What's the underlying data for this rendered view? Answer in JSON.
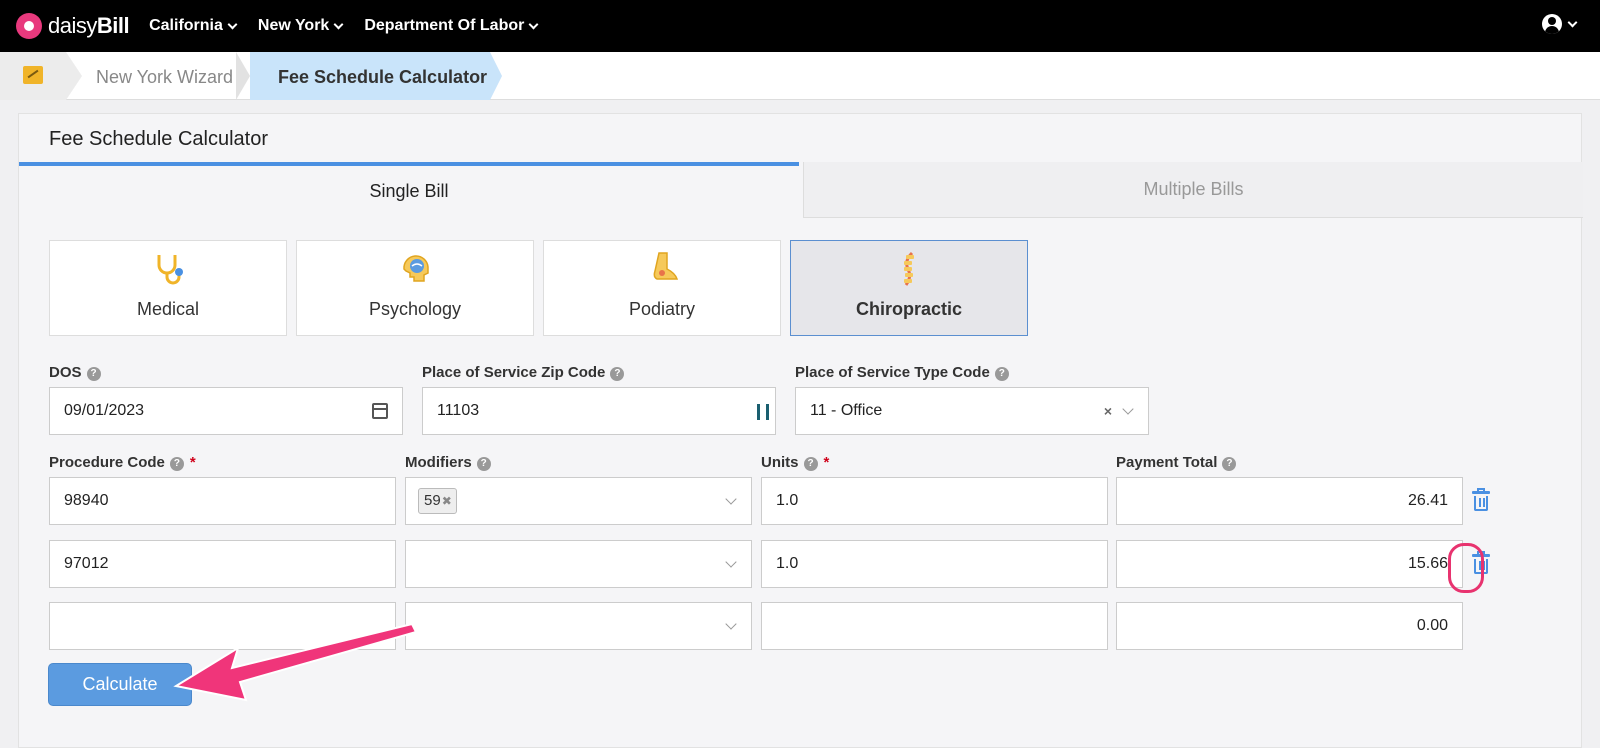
{
  "app": {
    "logo_text_light": "daisy",
    "logo_text_bold": "Bill"
  },
  "nav": {
    "items": [
      "California",
      "New York",
      "Department Of Labor"
    ]
  },
  "breadcrumb": {
    "link": "New York Wizard",
    "current": "Fee Schedule Calculator"
  },
  "panel": {
    "title": "Fee Schedule Calculator",
    "tabs": [
      "Single Bill",
      "Multiple Bills"
    ],
    "active_tab": "Single Bill"
  },
  "specialties": [
    {
      "label": "Medical",
      "icon": "stethoscope-icon",
      "active": false
    },
    {
      "label": "Psychology",
      "icon": "brain-icon",
      "active": false
    },
    {
      "label": "Podiatry",
      "icon": "foot-icon",
      "active": false
    },
    {
      "label": "Chiropractic",
      "icon": "spine-icon",
      "active": true
    }
  ],
  "form": {
    "dos_label": "DOS",
    "dos_value": "09/01/2023",
    "zip_label": "Place of Service Zip Code",
    "zip_value": "11103",
    "pos_type_label": "Place of Service Type Code",
    "pos_type_value": "11 - Office",
    "procedure_label": "Procedure Code",
    "modifiers_label": "Modifiers",
    "units_label": "Units",
    "payment_label": "Payment Total",
    "required_mark": "*",
    "help_glyph": "?"
  },
  "rows": [
    {
      "procedure": "98940",
      "modifiers": [
        "59"
      ],
      "units": "1.0",
      "payment": "26.41",
      "deletable": true
    },
    {
      "procedure": "97012",
      "modifiers": [],
      "units": "1.0",
      "payment": "15.66",
      "deletable": true
    },
    {
      "procedure": "",
      "modifiers": [],
      "units": "",
      "payment": "0.00",
      "deletable": false
    }
  ],
  "actions": {
    "calculate_label": "Calculate"
  },
  "colors": {
    "accent": "#4a90e2",
    "annotation": "#e8336f",
    "button": "#5b9be0",
    "breadcrumb_active": "#c9e4fa"
  }
}
